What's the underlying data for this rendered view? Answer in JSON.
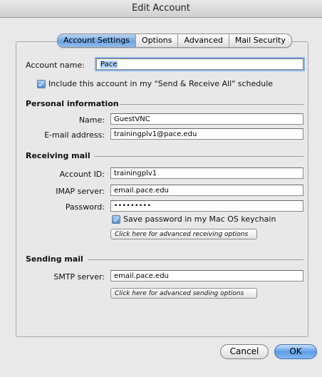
{
  "window": {
    "title": "Edit Account"
  },
  "tabs": [
    {
      "label": "Account Settings",
      "active": true
    },
    {
      "label": "Options",
      "active": false
    },
    {
      "label": "Advanced",
      "active": false
    },
    {
      "label": "Mail Security",
      "active": false
    }
  ],
  "account": {
    "name_label": "Account name:",
    "name_value": "Pace",
    "include_label": "Include this account in my \"Send & Receive All\" schedule",
    "include_checked": true
  },
  "personal": {
    "heading": "Personal information",
    "name_label": "Name:",
    "name_value": "GuestVNC",
    "email_label": "E-mail address:",
    "email_value": "trainingplv1@pace.edu"
  },
  "receiving": {
    "heading": "Receiving mail",
    "account_id_label": "Account ID:",
    "account_id_value": "trainingplv1",
    "imap_label": "IMAP server:",
    "imap_value": "email.pace.edu",
    "password_label": "Password:",
    "password_value": "•••••••••",
    "keychain_label": "Save password in my Mac OS keychain",
    "keychain_checked": true,
    "advanced_button": "Click here for advanced receiving options"
  },
  "sending": {
    "heading": "Sending mail",
    "smtp_label": "SMTP server:",
    "smtp_value": "email.pace.edu",
    "advanced_button": "Click here for advanced sending options"
  },
  "buttons": {
    "cancel": "Cancel",
    "ok": "OK"
  },
  "colors": {
    "accent": "#5d9ce6",
    "tab_active": "#6ea3df"
  }
}
